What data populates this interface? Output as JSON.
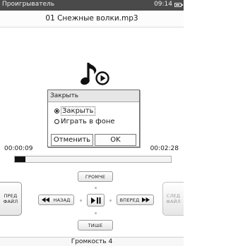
{
  "status_bar": {
    "app_title": "Проигрыватель",
    "time": "09:14",
    "battery_icon": "battery-icon"
  },
  "player": {
    "file_name": "01 Снежные волки.mp3",
    "art_icon": "music-note-play-icon",
    "elapsed": "00:00:09",
    "total": "00:02:28",
    "progress_fraction": 0.07
  },
  "controls": {
    "volume_up": "ГРОМЧЕ",
    "volume_down": "ТИШЕ",
    "back": "НАЗАД",
    "forward": "ВПЕРЕД",
    "play_pause_icon": "play-pause-icon",
    "prev_file_line1": "ПРЕД",
    "prev_file_line2": "ФАЙЛ",
    "next_file_line1": "СЛЕД",
    "next_file_line2": "ФАЙЛ"
  },
  "volume_text": "Громкость 4",
  "dialog": {
    "title": "Закрыть",
    "options": [
      {
        "label": "Закрыть",
        "selected": true
      },
      {
        "label": "Играть в фоне",
        "selected": false
      }
    ],
    "cancel_label": "Отменить",
    "ok_label": "OK"
  }
}
